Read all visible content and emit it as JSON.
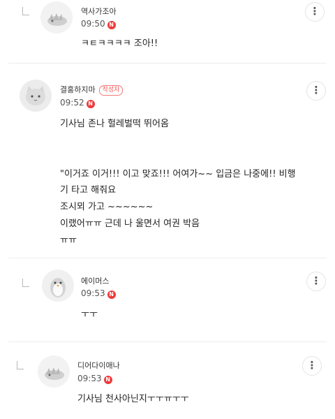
{
  "comments": [
    {
      "nickname": "역사가조아",
      "time": "09:50",
      "new_badge": "N",
      "more_icon": "⋮",
      "lines": [
        "ㅋㅌㅋㅋㅋㅋ 조아!!"
      ]
    },
    {
      "nickname": "결홍하지마",
      "author_badge": "작성자",
      "time": "09:52",
      "new_badge": "N",
      "more_icon": "⋮",
      "lines": [
        "기사님 존나 헐레벌떡 뛰어옴",
        "\"이거죠 이거!!! 이고 맞죠!!! 어여가~~ 입금은 나중에!! 비행",
        "기 타고 해줘요",
        "조시뫼 가고 ~~~~~~",
        "이랬어ㅠㅠ 근데 나 울면서 여권 박음",
        "ㅠㅠ"
      ]
    },
    {
      "nickname": "에이머스",
      "time": "09:53",
      "new_badge": "N",
      "more_icon": "⋮",
      "lines": [
        "ㅜㅜ"
      ]
    },
    {
      "nickname": "디어다이애나",
      "time": "09:53",
      "new_badge": "N",
      "more_icon": "⋮",
      "lines": [
        "기사님 천사아닌지ㅜㅜㅠㅜㅜ"
      ]
    }
  ]
}
